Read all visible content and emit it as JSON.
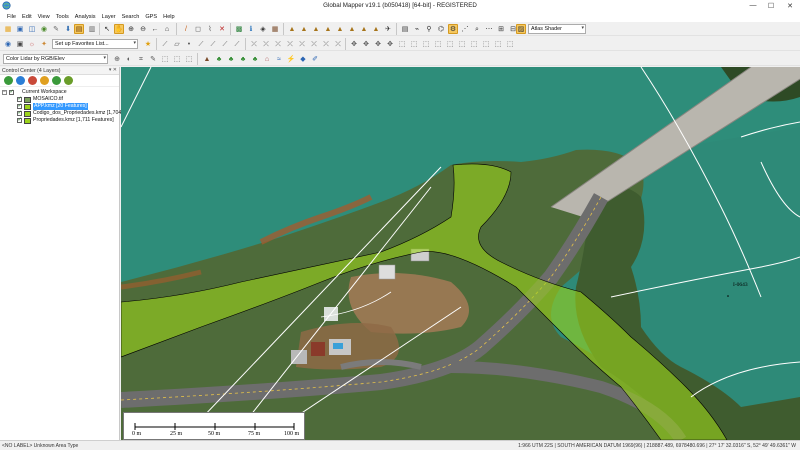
{
  "window": {
    "title": "Global Mapper v19.1 (b050418) [64-bit] - REGISTERED",
    "minimize": "—",
    "maximize": "☐",
    "close": "✕"
  },
  "menu": [
    "File",
    "Edit",
    "View",
    "Tools",
    "Analysis",
    "Layer",
    "Search",
    "GPS",
    "Help"
  ],
  "toolbars": {
    "atlas_shader": "Atlas Shader",
    "favorites": "Set up Favorites List...",
    "color_mode": "Color Lidar by RGB/Elev"
  },
  "control_center": {
    "title": "Control Center (4 Layers)",
    "workspace": "Current Workspace",
    "layers": [
      {
        "name": "MOSAICO.tif",
        "selected": false
      },
      {
        "name": "APP.kmz [20 Features]",
        "selected": true
      },
      {
        "name": "Codigo_dos_Propriedades.kmz [1,704 Fe",
        "selected": false
      },
      {
        "name": "Propriedades.kmz [1,711 Features]",
        "selected": false
      }
    ]
  },
  "map": {
    "water_color": "#2e8a78",
    "green_overlay": "#9bd31b",
    "annotation": "I-0643",
    "scale_labels": [
      "0 m",
      "25 m",
      "50 m",
      "75 m",
      "100 m"
    ]
  },
  "status": {
    "left": "<NO LABEL> Unknown Area Type",
    "right": "1:966  UTM 22S | SOUTH AMERICAN DATUM 1969(96) | 218887.489, 6978480.696 | 27° 17' 32.0316\" S, 52° 49' 49.6361\" W"
  }
}
